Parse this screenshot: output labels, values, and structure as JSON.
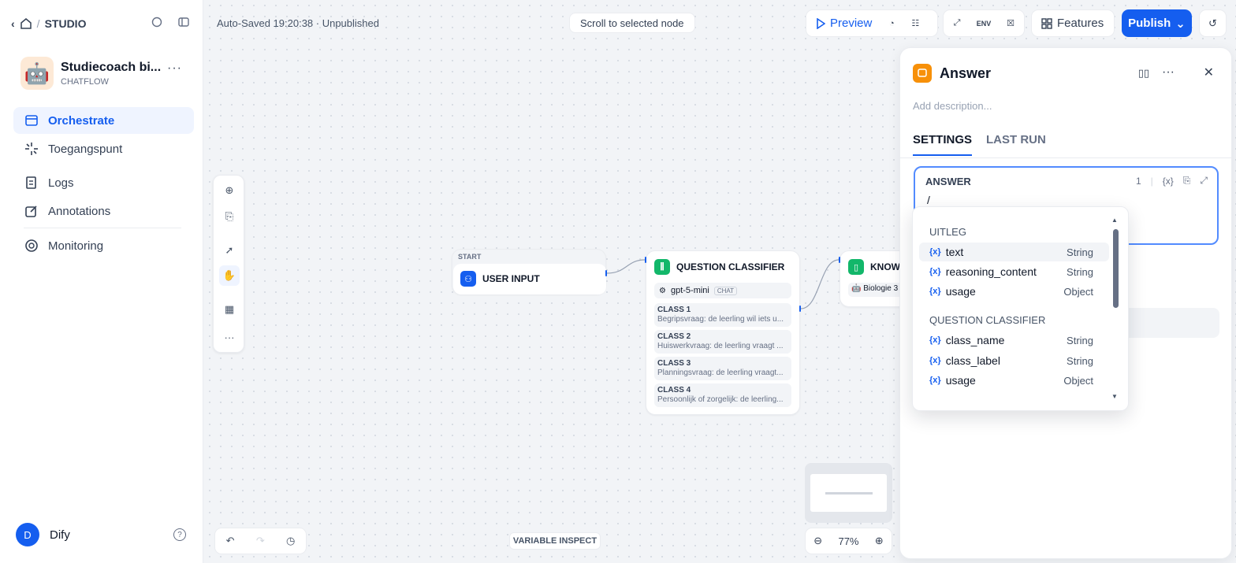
{
  "header": {
    "studio": "STUDIO"
  },
  "app": {
    "name": "Studiecoach bi...",
    "type": "CHATFLOW",
    "emoji": "🤖"
  },
  "nav": [
    {
      "label": "Orchestrate",
      "icon": "orchestrate-icon"
    },
    {
      "label": "Toegangspunt",
      "icon": "access-point-icon"
    },
    {
      "label": "Logs",
      "icon": "logs-icon"
    },
    {
      "label": "Annotations",
      "icon": "annotations-icon"
    },
    {
      "label": "Monitoring",
      "icon": "monitoring-icon"
    }
  ],
  "user": {
    "initial": "D",
    "name": "Dify"
  },
  "toolbar": {
    "saved": "Auto-Saved 19:20:38 · Unpublished",
    "scroll_btn": "Scroll to selected node",
    "preview": "Preview",
    "env": "ENV",
    "features": "Features",
    "publish": "Publish"
  },
  "nodes": {
    "start": {
      "tag": "START",
      "title": "USER INPUT"
    },
    "classifier": {
      "title": "QUESTION CLASSIFIER",
      "model": "gpt-5-mini",
      "model_tag": "CHAT",
      "classes": [
        {
          "name": "CLASS 1",
          "desc": "Begripsvraag: de leerling wil iets u..."
        },
        {
          "name": "CLASS 2",
          "desc": "Huiswerkvraag: de leerling vraagt ..."
        },
        {
          "name": "CLASS 3",
          "desc": "Planningsvraag: de leerling vraagt..."
        },
        {
          "name": "CLASS 4",
          "desc": "Persoonlijk of zorgelijk: de leerling..."
        }
      ]
    },
    "knowledge": {
      "title": "KNOWL",
      "item": "Biologie 3"
    }
  },
  "bottom": {
    "variable_inspect": "VARIABLE INSPECT",
    "zoom": "77%"
  },
  "panel": {
    "title": "Answer",
    "description_placeholder": "Add description...",
    "tabs": [
      "SETTINGS",
      "LAST RUN"
    ],
    "answer_label": "ANSWER",
    "answer_count": "1",
    "var_btn": "{x}",
    "answer_value": "/"
  },
  "dropdown": {
    "groups": [
      {
        "title": "UITLEG",
        "vars": [
          {
            "name": "text",
            "type": "String"
          },
          {
            "name": "reasoning_content",
            "type": "String"
          },
          {
            "name": "usage",
            "type": "Object"
          }
        ]
      },
      {
        "title": "QUESTION CLASSIFIER",
        "vars": [
          {
            "name": "class_name",
            "type": "String"
          },
          {
            "name": "class_label",
            "type": "String"
          },
          {
            "name": "usage",
            "type": "Object"
          }
        ]
      }
    ],
    "var_prefix": "{x}"
  }
}
